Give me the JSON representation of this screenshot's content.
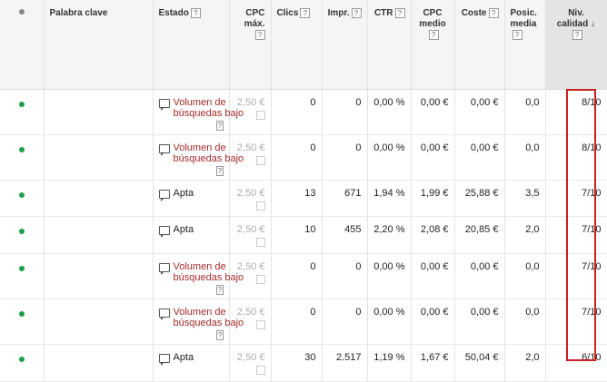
{
  "headers": {
    "keyword": "Palabra clave",
    "status": "Estado",
    "max_cpc": "CPC máx.",
    "clicks": "Clics",
    "impr": "Impr.",
    "ctr": "CTR",
    "avg_cpc": "CPC medio",
    "cost": "Coste",
    "avg_pos": "Posic. media",
    "quality": "Niv. calidad",
    "help": "?"
  },
  "rows": [
    {
      "status": "Volumen de búsquedas bajo",
      "low": true,
      "cpc": "2,50 €",
      "clicks": "0",
      "impr": "0",
      "ctr": "0,00 %",
      "avgcpc": "0,00 €",
      "cost": "0,00 €",
      "pos": "0,0",
      "qs": "8/10"
    },
    {
      "status": "Volumen de búsquedas bajo",
      "low": true,
      "cpc": "2,50 €",
      "clicks": "0",
      "impr": "0",
      "ctr": "0,00 %",
      "avgcpc": "0,00 €",
      "cost": "0,00 €",
      "pos": "0,0",
      "qs": "8/10"
    },
    {
      "status": "Apta",
      "low": false,
      "cpc": "2,50 €",
      "clicks": "13",
      "impr": "671",
      "ctr": "1,94 %",
      "avgcpc": "1,99 €",
      "cost": "25,88 €",
      "pos": "3,5",
      "qs": "7/10"
    },
    {
      "status": "Apta",
      "low": false,
      "cpc": "2,50 €",
      "clicks": "10",
      "impr": "455",
      "ctr": "2,20 %",
      "avgcpc": "2,08 €",
      "cost": "20,85 €",
      "pos": "2,0",
      "qs": "7/10"
    },
    {
      "status": "Volumen de búsquedas bajo",
      "low": true,
      "cpc": "2,50 €",
      "clicks": "0",
      "impr": "0",
      "ctr": "0,00 %",
      "avgcpc": "0,00 €",
      "cost": "0,00 €",
      "pos": "0,0",
      "qs": "7/10"
    },
    {
      "status": "Volumen de búsquedas bajo",
      "low": true,
      "cpc": "2,50 €",
      "clicks": "0",
      "impr": "0",
      "ctr": "0,00 %",
      "avgcpc": "0,00 €",
      "cost": "0,00 €",
      "pos": "0,0",
      "qs": "7/10"
    },
    {
      "status": "Apta",
      "low": false,
      "cpc": "2,50 €",
      "clicks": "30",
      "impr": "2.517",
      "ctr": "1,19 %",
      "avgcpc": "1,67 €",
      "cost": "50,04 €",
      "pos": "2,0",
      "qs": "6/10"
    }
  ],
  "colors": {
    "enabled_dot": "#1e9e4a",
    "low_volume_text": "#a52a2a",
    "highlight": "#cc1f1f"
  },
  "icons": {
    "status": "comment-icon",
    "sort": "arrow-down-icon"
  }
}
